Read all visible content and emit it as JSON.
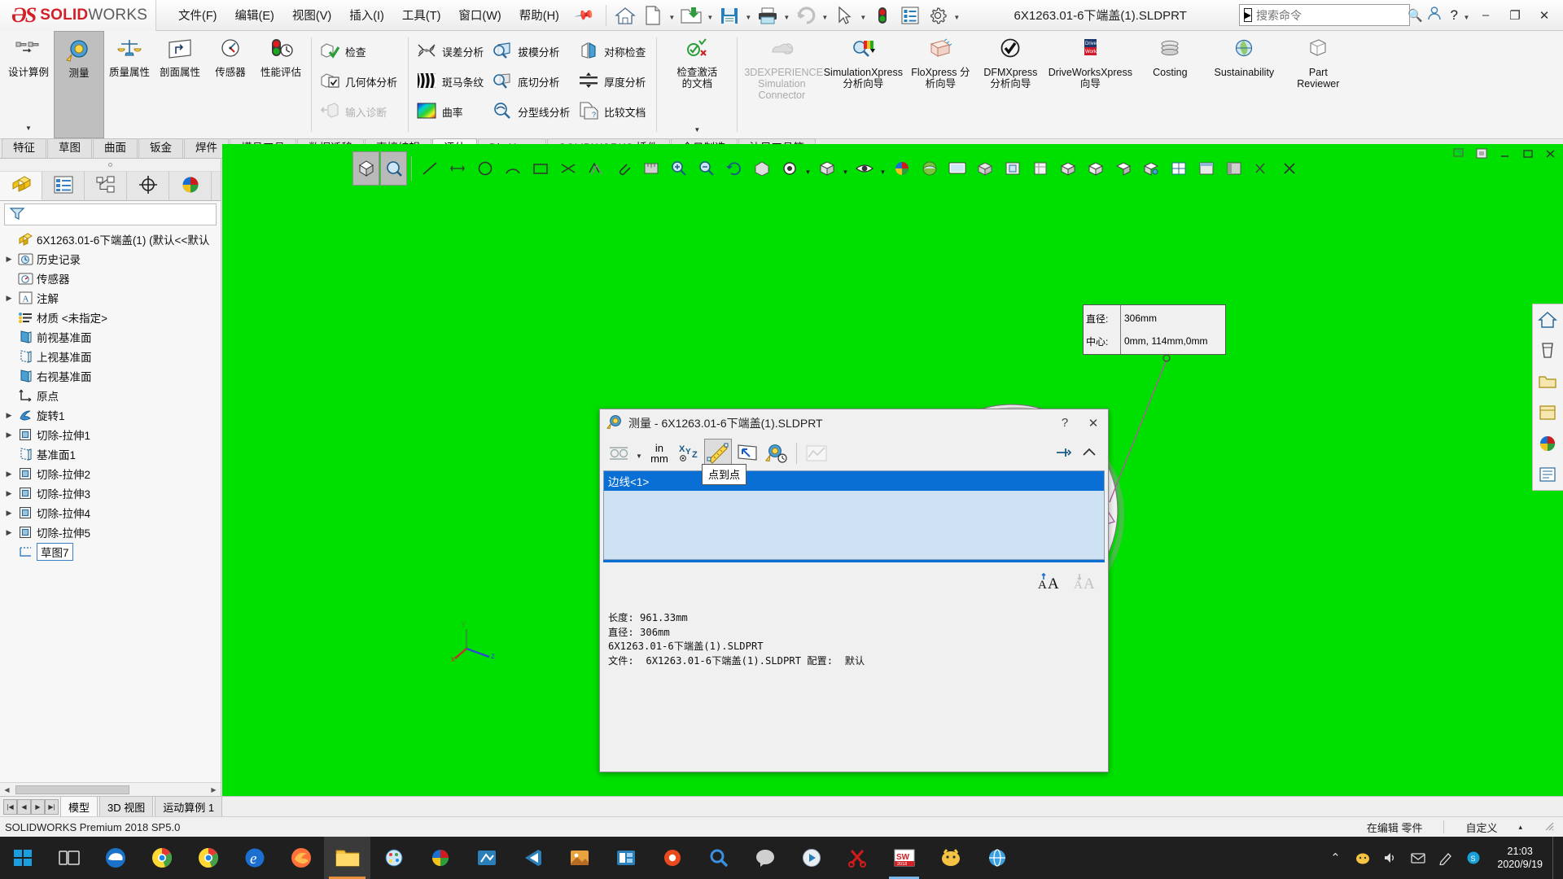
{
  "app": {
    "brand_bold": "SOLID",
    "brand_light": "WORKS",
    "document_title": "6X1263.01-6下端盖(1).SLDPRT"
  },
  "menubar": {
    "items": [
      {
        "label": "文件(F)"
      },
      {
        "label": "编辑(E)"
      },
      {
        "label": "视图(V)"
      },
      {
        "label": "插入(I)"
      },
      {
        "label": "工具(T)"
      },
      {
        "label": "窗口(W)"
      },
      {
        "label": "帮助(H)"
      }
    ],
    "pin_icon": "pushpin-icon"
  },
  "quick_toolbar": {
    "buttons": [
      {
        "name": "home-icon",
        "caret": false
      },
      {
        "name": "new-document-icon",
        "caret": true
      },
      {
        "name": "open-folder-icon",
        "caret": true
      },
      {
        "name": "save-icon",
        "caret": true
      },
      {
        "name": "print-icon",
        "caret": true
      },
      {
        "name": "undo-icon",
        "caret": true
      },
      {
        "name": "select-cursor-icon",
        "caret": true
      },
      {
        "name": "rebuild-icon",
        "caret": false
      },
      {
        "name": "options-list-icon",
        "caret": false
      },
      {
        "name": "settings-gear-icon",
        "caret": true
      }
    ]
  },
  "search": {
    "placeholder": "搜索命令",
    "icon": "search-icon"
  },
  "window_buttons": {
    "user": "user-account-icon",
    "help": "help-icon",
    "minimize": "–",
    "maximize": "❐",
    "close": "✕"
  },
  "ribbon": {
    "groups": [
      {
        "type": "big",
        "items": [
          {
            "label": "设计算例",
            "icon": "design-study-icon",
            "active": false,
            "caret": true
          },
          {
            "label": "测量",
            "icon": "measure-tape-icon",
            "active": true,
            "caret": false
          },
          {
            "label": "质量属性",
            "icon": "mass-properties-icon",
            "active": false,
            "caret": false
          },
          {
            "label": "剖面属性",
            "icon": "section-properties-icon",
            "active": false,
            "caret": false
          },
          {
            "label": "传感器",
            "icon": "sensor-gauge-icon",
            "active": false,
            "caret": false
          },
          {
            "label": "性能评估",
            "icon": "performance-evaluation-icon",
            "active": false,
            "caret": false
          }
        ]
      },
      {
        "type": "rows",
        "items": [
          {
            "label": "检查",
            "icon": "check-geometry-icon",
            "dim": false
          },
          {
            "label": "几何体分析",
            "icon": "geometry-analysis-icon",
            "dim": false
          },
          {
            "label": "输入诊断",
            "icon": "import-diagnostics-icon",
            "dim": true
          }
        ]
      },
      {
        "type": "rows",
        "items": [
          {
            "label": "误差分析",
            "icon": "deviation-analysis-icon",
            "dim": false
          },
          {
            "label": "斑马条纹",
            "icon": "zebra-stripes-icon",
            "dim": false
          },
          {
            "label": "曲率",
            "icon": "curvature-icon",
            "dim": false
          }
        ]
      },
      {
        "type": "rows",
        "items": [
          {
            "label": "拔模分析",
            "icon": "draft-analysis-icon",
            "dim": false
          },
          {
            "label": "底切分析",
            "icon": "undercut-analysis-icon",
            "dim": false
          },
          {
            "label": "分型线分析",
            "icon": "parting-line-analysis-icon",
            "dim": false
          }
        ]
      },
      {
        "type": "rows",
        "items": [
          {
            "label": "对称检查",
            "icon": "symmetry-check-icon",
            "dim": false
          },
          {
            "label": "厚度分析",
            "icon": "thickness-analysis-icon",
            "dim": false
          },
          {
            "label": "比较文档",
            "icon": "compare-documents-icon",
            "dim": false
          }
        ]
      },
      {
        "type": "big",
        "items": [
          {
            "label": "检查激活的文档",
            "icon": "check-active-document-icon",
            "active": false,
            "caret": true
          }
        ]
      },
      {
        "type": "big",
        "items": [
          {
            "label": "3DEXPERIENCE Simulation Connector",
            "icon": "3dexperience-simulation-icon",
            "active": false,
            "dim": true,
            "caret": false
          },
          {
            "label": "SimulationXpress 分析向导",
            "icon": "simulationxpress-icon",
            "active": false,
            "caret": false
          },
          {
            "label": "FloXpress 分析向导",
            "icon": "floxpress-icon",
            "active": false,
            "caret": false
          },
          {
            "label": "DFMXpress 分析向导",
            "icon": "dfmxpress-icon",
            "active": false,
            "caret": false
          },
          {
            "label": "DriveWorksXpress 向导",
            "icon": "driveworksxpress-icon",
            "active": false,
            "caret": false
          },
          {
            "label": "Costing",
            "icon": "costing-coins-icon",
            "active": false,
            "caret": false
          },
          {
            "label": "Sustainability",
            "icon": "sustainability-icon",
            "active": false,
            "caret": false
          },
          {
            "label": "Part Reviewer",
            "icon": "part-reviewer-icon",
            "active": false,
            "caret": false
          }
        ]
      }
    ]
  },
  "command_tabs": {
    "items": [
      {
        "label": "特征",
        "active": false
      },
      {
        "label": "草图",
        "active": false
      },
      {
        "label": "曲面",
        "active": false
      },
      {
        "label": "钣金",
        "active": false
      },
      {
        "label": "焊件",
        "active": false
      },
      {
        "label": "模具工具",
        "active": false
      },
      {
        "label": "数据迁移",
        "active": false
      },
      {
        "label": "直接编辑",
        "active": false
      },
      {
        "label": "评估",
        "active": true
      },
      {
        "label": "DimXpert",
        "active": false
      },
      {
        "label": "SOLIDWORKS 插件",
        "active": false
      },
      {
        "label": "今日制造",
        "active": false
      },
      {
        "label": "沐风工具箱",
        "active": false
      }
    ]
  },
  "left_panel": {
    "tabs": [
      {
        "name": "feature-manager-tab",
        "icon": "feature-tree-icon",
        "active": true
      },
      {
        "name": "property-manager-tab",
        "icon": "property-list-icon",
        "active": false
      },
      {
        "name": "configuration-manager-tab",
        "icon": "configuration-icon",
        "active": false
      },
      {
        "name": "dimxpert-manager-tab",
        "icon": "dimxpert-target-icon",
        "active": false
      },
      {
        "name": "display-manager-tab",
        "icon": "display-sphere-icon",
        "active": false
      }
    ],
    "filter_icon": "filter-funnel-icon",
    "tree": [
      {
        "label": "6X1263.01-6下端盖(1)  (默认<<默认",
        "icon": "part-icon",
        "indent": 0,
        "arrow": false,
        "root": true
      },
      {
        "label": "历史记录",
        "icon": "history-icon",
        "indent": 1,
        "arrow": true
      },
      {
        "label": "传感器",
        "icon": "sensors-icon",
        "indent": 1,
        "arrow": false
      },
      {
        "label": "注解",
        "icon": "annotations-icon",
        "indent": 1,
        "arrow": true
      },
      {
        "label": "材质 <未指定>",
        "icon": "material-icon",
        "indent": 1,
        "arrow": false
      },
      {
        "label": "前视基准面",
        "icon": "plane-icon",
        "indent": 1,
        "arrow": false
      },
      {
        "label": "上视基准面",
        "icon": "plane-icon",
        "indent": 1,
        "arrow": false
      },
      {
        "label": "右视基准面",
        "icon": "plane-icon",
        "indent": 1,
        "arrow": false
      },
      {
        "label": "原点",
        "icon": "origin-icon",
        "indent": 1,
        "arrow": false
      },
      {
        "label": "旋转1",
        "icon": "revolve-icon",
        "indent": 1,
        "arrow": true
      },
      {
        "label": "切除-拉伸1",
        "icon": "extrude-cut-icon",
        "indent": 1,
        "arrow": true
      },
      {
        "label": "基准面1",
        "icon": "plane-icon",
        "indent": 1,
        "arrow": false
      },
      {
        "label": "切除-拉伸2",
        "icon": "extrude-cut-icon",
        "indent": 1,
        "arrow": true
      },
      {
        "label": "切除-拉伸3",
        "icon": "extrude-cut-icon",
        "indent": 1,
        "arrow": true
      },
      {
        "label": "切除-拉伸4",
        "icon": "extrude-cut-icon",
        "indent": 1,
        "arrow": true
      },
      {
        "label": "切除-拉伸5",
        "icon": "extrude-cut-icon",
        "indent": 1,
        "arrow": true
      },
      {
        "label": "草图7",
        "icon": "sketch-icon",
        "indent": 1,
        "arrow": false,
        "selected": true
      }
    ]
  },
  "view_toolbar": {
    "buttons": [
      {
        "name": "zoom-to-fit-icon",
        "active": true,
        "caret": false
      },
      {
        "name": "zoom-to-area-icon",
        "active": true,
        "caret": false
      },
      {
        "name": "line-icon",
        "active": false,
        "caret": false
      },
      {
        "name": "dimension-icon",
        "active": false,
        "caret": false
      },
      {
        "name": "circle-icon",
        "active": false,
        "caret": false
      },
      {
        "name": "arc-icon",
        "active": false,
        "caret": false
      },
      {
        "name": "rectangle-icon",
        "active": false,
        "caret": false
      },
      {
        "name": "trim-icon",
        "active": false,
        "caret": false
      },
      {
        "name": "offset-icon",
        "active": false,
        "caret": false
      },
      {
        "name": "attach-icon",
        "active": false,
        "caret": false
      },
      {
        "name": "measure-small-icon",
        "active": false,
        "caret": false
      },
      {
        "name": "zoom-in-icon",
        "active": false,
        "caret": false
      },
      {
        "name": "zoom-out-icon",
        "active": false,
        "caret": false
      },
      {
        "name": "rotate-view-icon",
        "active": false,
        "caret": false
      },
      {
        "name": "pan-view-icon",
        "active": false,
        "caret": false
      },
      {
        "name": "view-orientation-icon",
        "active": false,
        "caret": true
      },
      {
        "name": "display-style-icon",
        "active": false,
        "caret": true
      },
      {
        "name": "hide-show-icon",
        "active": false,
        "caret": true
      },
      {
        "name": "appearance-sphere-icon",
        "active": false,
        "caret": false
      },
      {
        "name": "scene-icon",
        "active": false,
        "caret": false
      },
      {
        "name": "apply-scene-icon",
        "active": false,
        "caret": false
      },
      {
        "name": "view-settings-icon",
        "active": false,
        "caret": false
      },
      {
        "name": "section-view-icon",
        "active": false,
        "caret": false
      },
      {
        "name": "cube-view-icon",
        "active": false,
        "caret": false
      },
      {
        "name": "box-a-icon",
        "active": false,
        "caret": false
      },
      {
        "name": "box-b-icon",
        "active": false,
        "caret": false
      },
      {
        "name": "box-c-icon",
        "active": false,
        "caret": false
      },
      {
        "name": "box-d-icon",
        "active": false,
        "caret": false
      },
      {
        "name": "grid-icon",
        "active": false,
        "caret": false
      },
      {
        "name": "viewport-icon",
        "active": false,
        "caret": false
      },
      {
        "name": "panel-icon",
        "active": false,
        "caret": false
      },
      {
        "name": "erase-icon",
        "active": false,
        "caret": false
      },
      {
        "name": "close-x-icon",
        "active": false,
        "caret": false
      }
    ]
  },
  "callout": {
    "label_1": "直径:",
    "value_1": "306mm",
    "label_2": "中心:",
    "value_2": "0mm, 114mm,0mm",
    "dropdowns": [
      "dimension-style-icon",
      "cube-style-icon",
      "eye-visibility-icon"
    ]
  },
  "measure_dialog": {
    "title": "测量 - 6X1263.01-6下端盖(1).SLDPRT",
    "titlebar_icon": "measure-tape-icon",
    "help_button": "?",
    "close_button": "✕",
    "tools": [
      {
        "name": "arc-condition-icon",
        "caret": true,
        "active": false
      },
      {
        "name": "units-precision-icon",
        "caret": false,
        "active": false,
        "label_top": "in",
        "label_bottom": "mm"
      },
      {
        "name": "xyz-projection-icon",
        "caret": false,
        "active": false
      },
      {
        "name": "point-to-point-icon",
        "caret": false,
        "active": true
      },
      {
        "name": "projected-on-icon",
        "caret": true,
        "active": false
      },
      {
        "name": "measure-history-icon",
        "caret": false,
        "active": false
      },
      {
        "name": "chart-icon",
        "caret": false,
        "active": false,
        "dim": true
      }
    ],
    "pin_icon": "pushpin-icon",
    "collapse_icon": "chevron-up-icon",
    "tooltip": "点到点",
    "selection": "边线<1>",
    "font_increase_icon": "font-increase-icon",
    "font_decrease_icon": "font-decrease-icon",
    "results": [
      "长度: 961.33mm",
      "直径: 306mm",
      "6X1263.01-6下端盖(1).SLDPRT",
      "文件:  6X1263.01-6下端盖(1).SLDPRT 配置:  默认"
    ]
  },
  "right_dock": {
    "buttons": [
      {
        "name": "home-panel-icon"
      },
      {
        "name": "appearances-panel-icon"
      },
      {
        "name": "open-folder-panel-icon"
      },
      {
        "name": "library-panel-icon"
      },
      {
        "name": "appearance-sphere-panel-icon"
      },
      {
        "name": "custom-properties-panel-icon"
      }
    ]
  },
  "graphics_window_buttons": {
    "buttons": [
      "restore-window-icon",
      "pin-window-icon",
      "minimize-window-icon",
      "maximize-window-icon",
      "close-window-icon"
    ]
  },
  "bottom_tabs": {
    "nav": [
      "|◀",
      "◀",
      "▶",
      "▶|"
    ],
    "items": [
      {
        "label": "模型",
        "active": true
      },
      {
        "label": "3D 视图",
        "active": false
      },
      {
        "label": "运动算例 1",
        "active": false
      }
    ]
  },
  "status_bar": {
    "left": "SOLIDWORKS Premium 2018 SP5.0",
    "editing": "在编辑 零件",
    "custom": "自定义",
    "caret": "▴"
  },
  "taskbar": {
    "start_icon": "windows-start-icon",
    "items": [
      {
        "name": "task-view-icon",
        "glyph": "▤"
      },
      {
        "name": "edge-browser-icon",
        "glyph": "e"
      },
      {
        "name": "chrome-browser-icon",
        "glyph": "◉"
      },
      {
        "name": "chrome-alt-icon",
        "glyph": "◉"
      },
      {
        "name": "internet-explorer-icon",
        "glyph": "e"
      },
      {
        "name": "firefox-browser-icon",
        "glyph": "🦊"
      },
      {
        "name": "file-explorer-icon",
        "glyph": "📁",
        "active": true
      },
      {
        "name": "paint-icon",
        "glyph": "🎨"
      },
      {
        "name": "color-tool-icon",
        "glyph": "◕"
      },
      {
        "name": "solidworks-viewer-icon",
        "glyph": "◐"
      },
      {
        "name": "vscode-icon",
        "glyph": "◣"
      },
      {
        "name": "photo-app-icon",
        "glyph": "▣"
      },
      {
        "name": "teams-icon",
        "glyph": "▦"
      },
      {
        "name": "settings-app-icon",
        "glyph": "⚙"
      },
      {
        "name": "search-tool-icon",
        "glyph": "🔍"
      },
      {
        "name": "messenger-icon",
        "glyph": "💬"
      },
      {
        "name": "media-player-icon",
        "glyph": "◯"
      },
      {
        "name": "scissors-icon",
        "glyph": "✂"
      },
      {
        "name": "solidworks-2018-icon",
        "glyph": "SW"
      },
      {
        "name": "wechat-icon",
        "glyph": "🐱"
      },
      {
        "name": "browser-blue-icon",
        "glyph": "◉"
      }
    ],
    "tray": [
      {
        "name": "show-hidden-icons",
        "glyph": "⌃"
      },
      {
        "name": "tray-app-icon",
        "glyph": "🐱"
      },
      {
        "name": "volume-icon",
        "glyph": "🔊"
      },
      {
        "name": "tray-mail-icon",
        "glyph": "✉"
      },
      {
        "name": "tray-pen-icon",
        "glyph": "✎"
      },
      {
        "name": "tray-skype-icon",
        "glyph": "S"
      }
    ],
    "clock_time": "21:03",
    "clock_date": "2020/9/19"
  }
}
